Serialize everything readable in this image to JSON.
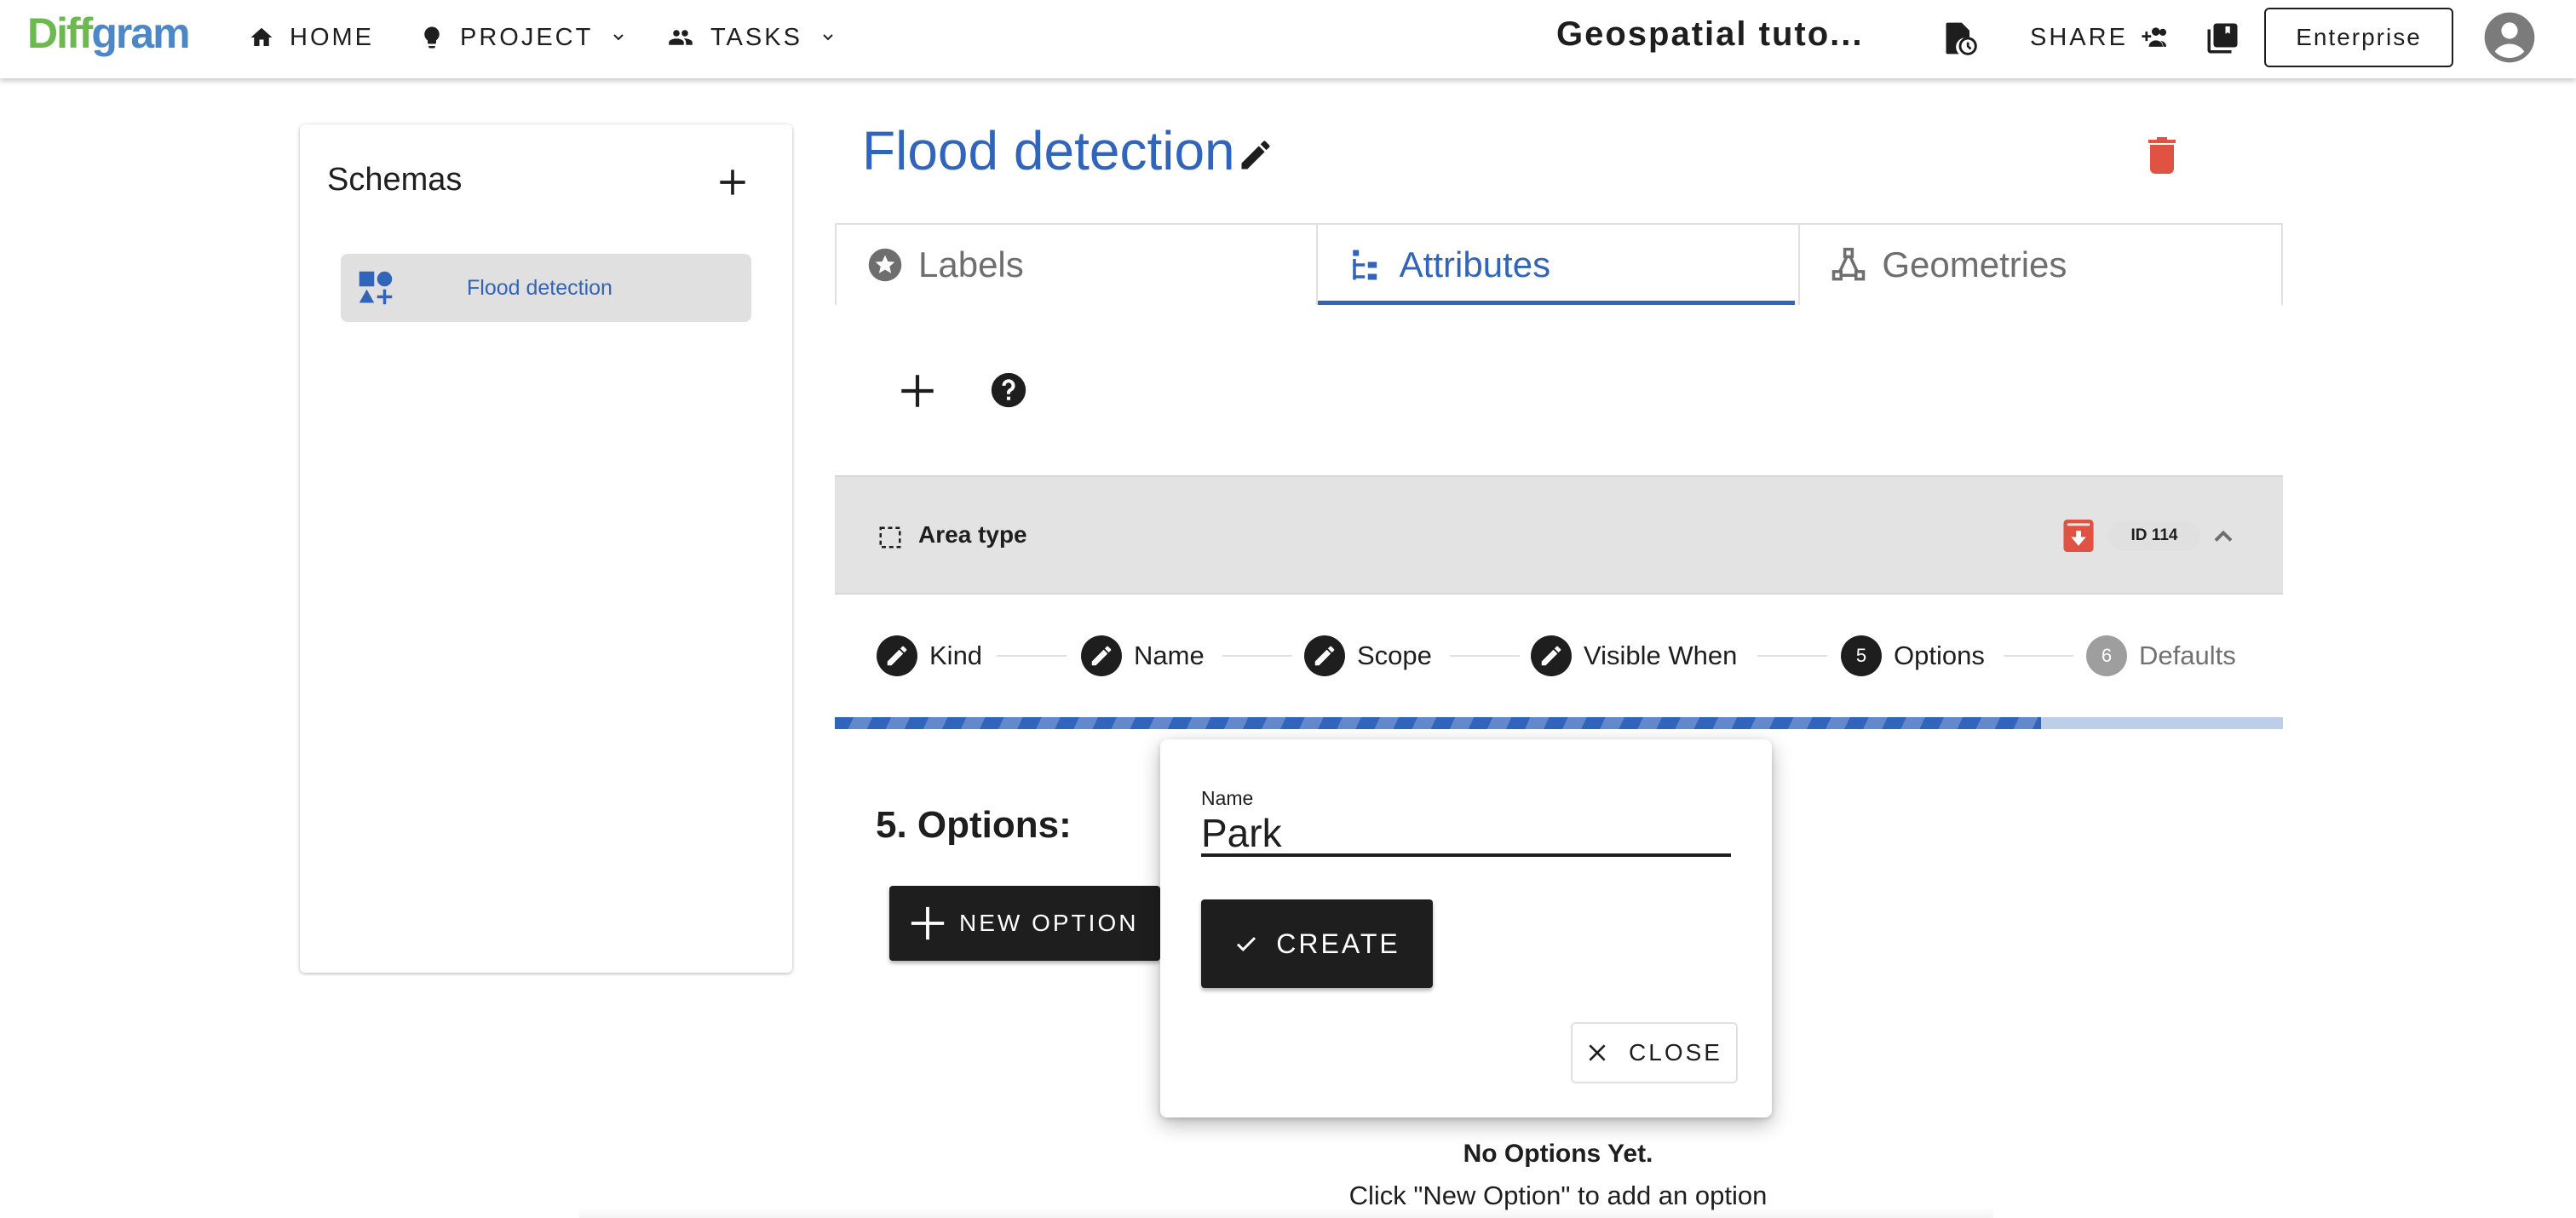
{
  "topbar": {
    "logo": {
      "part1": "Diff",
      "part2": "gram"
    },
    "nav": [
      {
        "label": "HOME",
        "icon": "home-icon"
      },
      {
        "label": "PROJECT",
        "icon": "lightbulb-icon",
        "has_dropdown": true
      },
      {
        "label": "TASKS",
        "icon": "people-icon",
        "has_dropdown": true
      }
    ],
    "project_title": "Geospatial tuto...",
    "share_label": "SHARE",
    "enterprise_label": "Enterprise",
    "icons": [
      "file-clock-icon",
      "add-person-icon",
      "library-books-icon",
      "account-avatar-icon"
    ]
  },
  "sidebar": {
    "title": "Schemas",
    "items": [
      {
        "label": "Flood detection",
        "icon": "shapes-icon",
        "selected": true
      }
    ]
  },
  "main": {
    "title": "Flood detection",
    "tabs": [
      {
        "label": "Labels",
        "icon": "star-circle-icon",
        "active": false
      },
      {
        "label": "Attributes",
        "icon": "tree-icon",
        "active": true
      },
      {
        "label": "Geometries",
        "icon": "vector-triangle-icon",
        "active": false
      }
    ],
    "attribute": {
      "name": "Area type",
      "id_badge": "ID 114"
    },
    "stepper": {
      "steps": [
        {
          "label": "Kind",
          "state": "edit",
          "number": "1"
        },
        {
          "label": "Name",
          "state": "edit",
          "number": "2"
        },
        {
          "label": "Scope",
          "state": "edit",
          "number": "3"
        },
        {
          "label": "Visible When",
          "state": "edit",
          "number": "4"
        },
        {
          "label": "Options",
          "state": "active",
          "number": "5"
        },
        {
          "label": "Defaults",
          "state": "pending",
          "number": "6"
        }
      ]
    },
    "progress_fraction": 0.833,
    "options_heading": "5. Options:",
    "new_option_label": "NEW OPTION",
    "empty_title": "No Options Yet.",
    "empty_subtitle": "Click \"New Option\" to add an option"
  },
  "popup": {
    "field_label": "Name",
    "field_value": "Park",
    "create_label": "CREATE",
    "close_label": "CLOSE"
  },
  "colors": {
    "accent": "#3164bb",
    "logo_green": "#6cb94f",
    "logo_blue": "#4c88c8",
    "danger": "#e05242",
    "dark": "#1e1e1e"
  }
}
